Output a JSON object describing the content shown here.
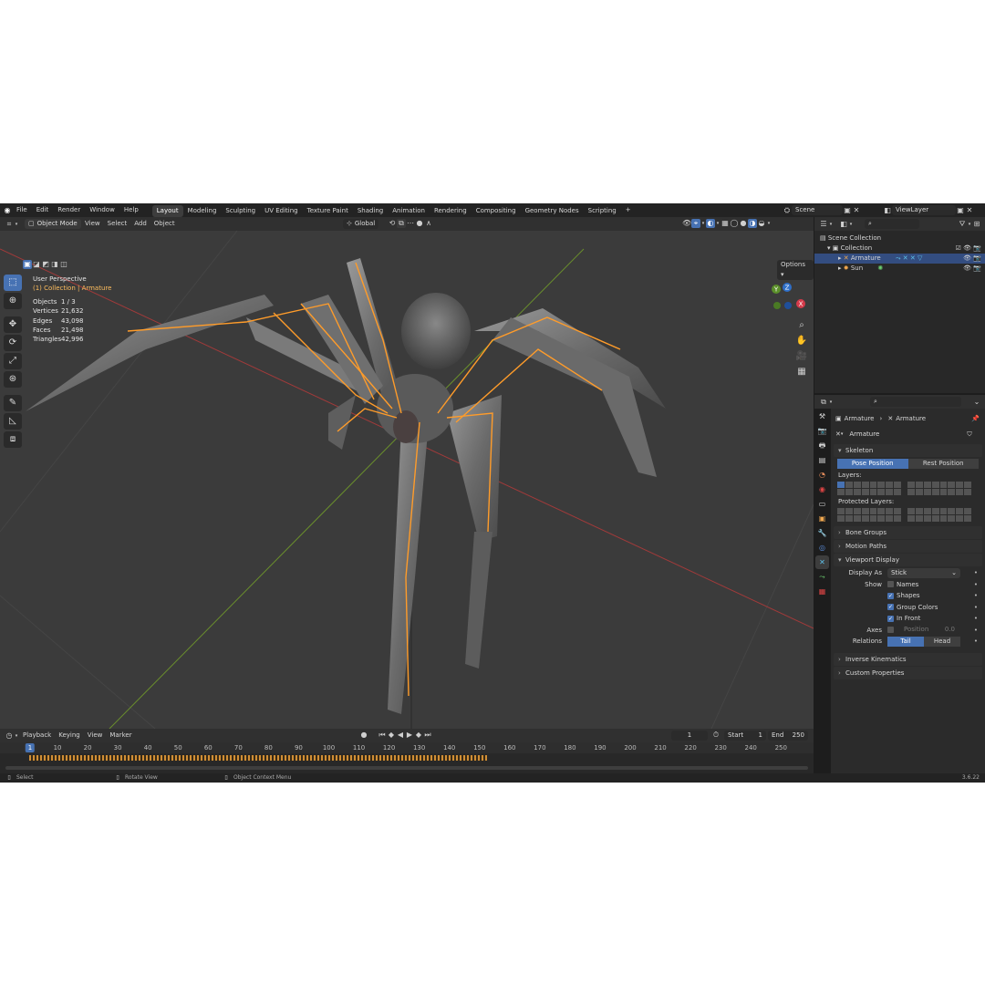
{
  "menu": [
    "File",
    "Edit",
    "Render",
    "Window",
    "Help"
  ],
  "workspaces": [
    {
      "label": "Layout",
      "active": true
    },
    {
      "label": "Modeling"
    },
    {
      "label": "Sculpting"
    },
    {
      "label": "UV Editing"
    },
    {
      "label": "Texture Paint"
    },
    {
      "label": "Shading"
    },
    {
      "label": "Animation"
    },
    {
      "label": "Rendering"
    },
    {
      "label": "Compositing"
    },
    {
      "label": "Geometry Nodes"
    },
    {
      "label": "Scripting"
    }
  ],
  "add_workspace": "+",
  "scene": "Scene",
  "view_layer": "ViewLayer",
  "viewport_header": {
    "mode": "Object Mode",
    "menus": [
      "View",
      "Select",
      "Add",
      "Object"
    ],
    "transform_orientation": "Global"
  },
  "overlay": {
    "perspective": "User Perspective",
    "collection": "(1) Collection | Armature",
    "stats": [
      {
        "label": "Objects",
        "value": "1 / 3"
      },
      {
        "label": "Vertices",
        "value": "21,632"
      },
      {
        "label": "Edges",
        "value": "43,098"
      },
      {
        "label": "Faces",
        "value": "21,498"
      },
      {
        "label": "Triangles",
        "value": "42,996"
      }
    ],
    "options": "Options",
    "gizmo": {
      "z": "Z",
      "y": "Y",
      "x": "X"
    }
  },
  "timeline": {
    "menus": [
      "Playback",
      "Keying",
      "View",
      "Marker"
    ],
    "current_frame": "1",
    "start_label": "Start",
    "start": "1",
    "end_label": "End",
    "end": "250",
    "ticks": [
      "1",
      "10",
      "20",
      "30",
      "40",
      "50",
      "60",
      "70",
      "80",
      "90",
      "100",
      "110",
      "120",
      "130",
      "140",
      "150",
      "160",
      "170",
      "180",
      "190",
      "200",
      "210",
      "220",
      "230",
      "240",
      "250"
    ]
  },
  "status": {
    "select": "Select",
    "rotate": "Rotate View",
    "context": "Object Context Menu",
    "version": "3.6.22"
  },
  "outliner": {
    "root": "Scene Collection",
    "collection": "Collection",
    "items": [
      {
        "name": "Armature",
        "selected": true
      },
      {
        "name": "Sun",
        "selected": false
      }
    ]
  },
  "properties": {
    "breadcrumb_object": "Armature",
    "breadcrumb_data": "Armature",
    "data_name": "Armature",
    "skeleton": "Skeleton",
    "pose_position": "Pose Position",
    "rest_position": "Rest Position",
    "layers": "Layers:",
    "protected_layers": "Protected Layers:",
    "bone_groups": "Bone Groups",
    "motion_paths": "Motion Paths",
    "viewport_display": "Viewport Display",
    "display_as_label": "Display As",
    "display_as": "Stick",
    "show_label": "Show",
    "names": "Names",
    "shapes": "Shapes",
    "group_colors": "Group Colors",
    "in_front": "In Front",
    "axes_label": "Axes",
    "position": "Position",
    "position_value": "0.0",
    "relations_label": "Relations",
    "tail": "Tail",
    "head": "Head",
    "inverse_kinematics": "Inverse Kinematics",
    "custom_properties": "Custom Properties"
  }
}
